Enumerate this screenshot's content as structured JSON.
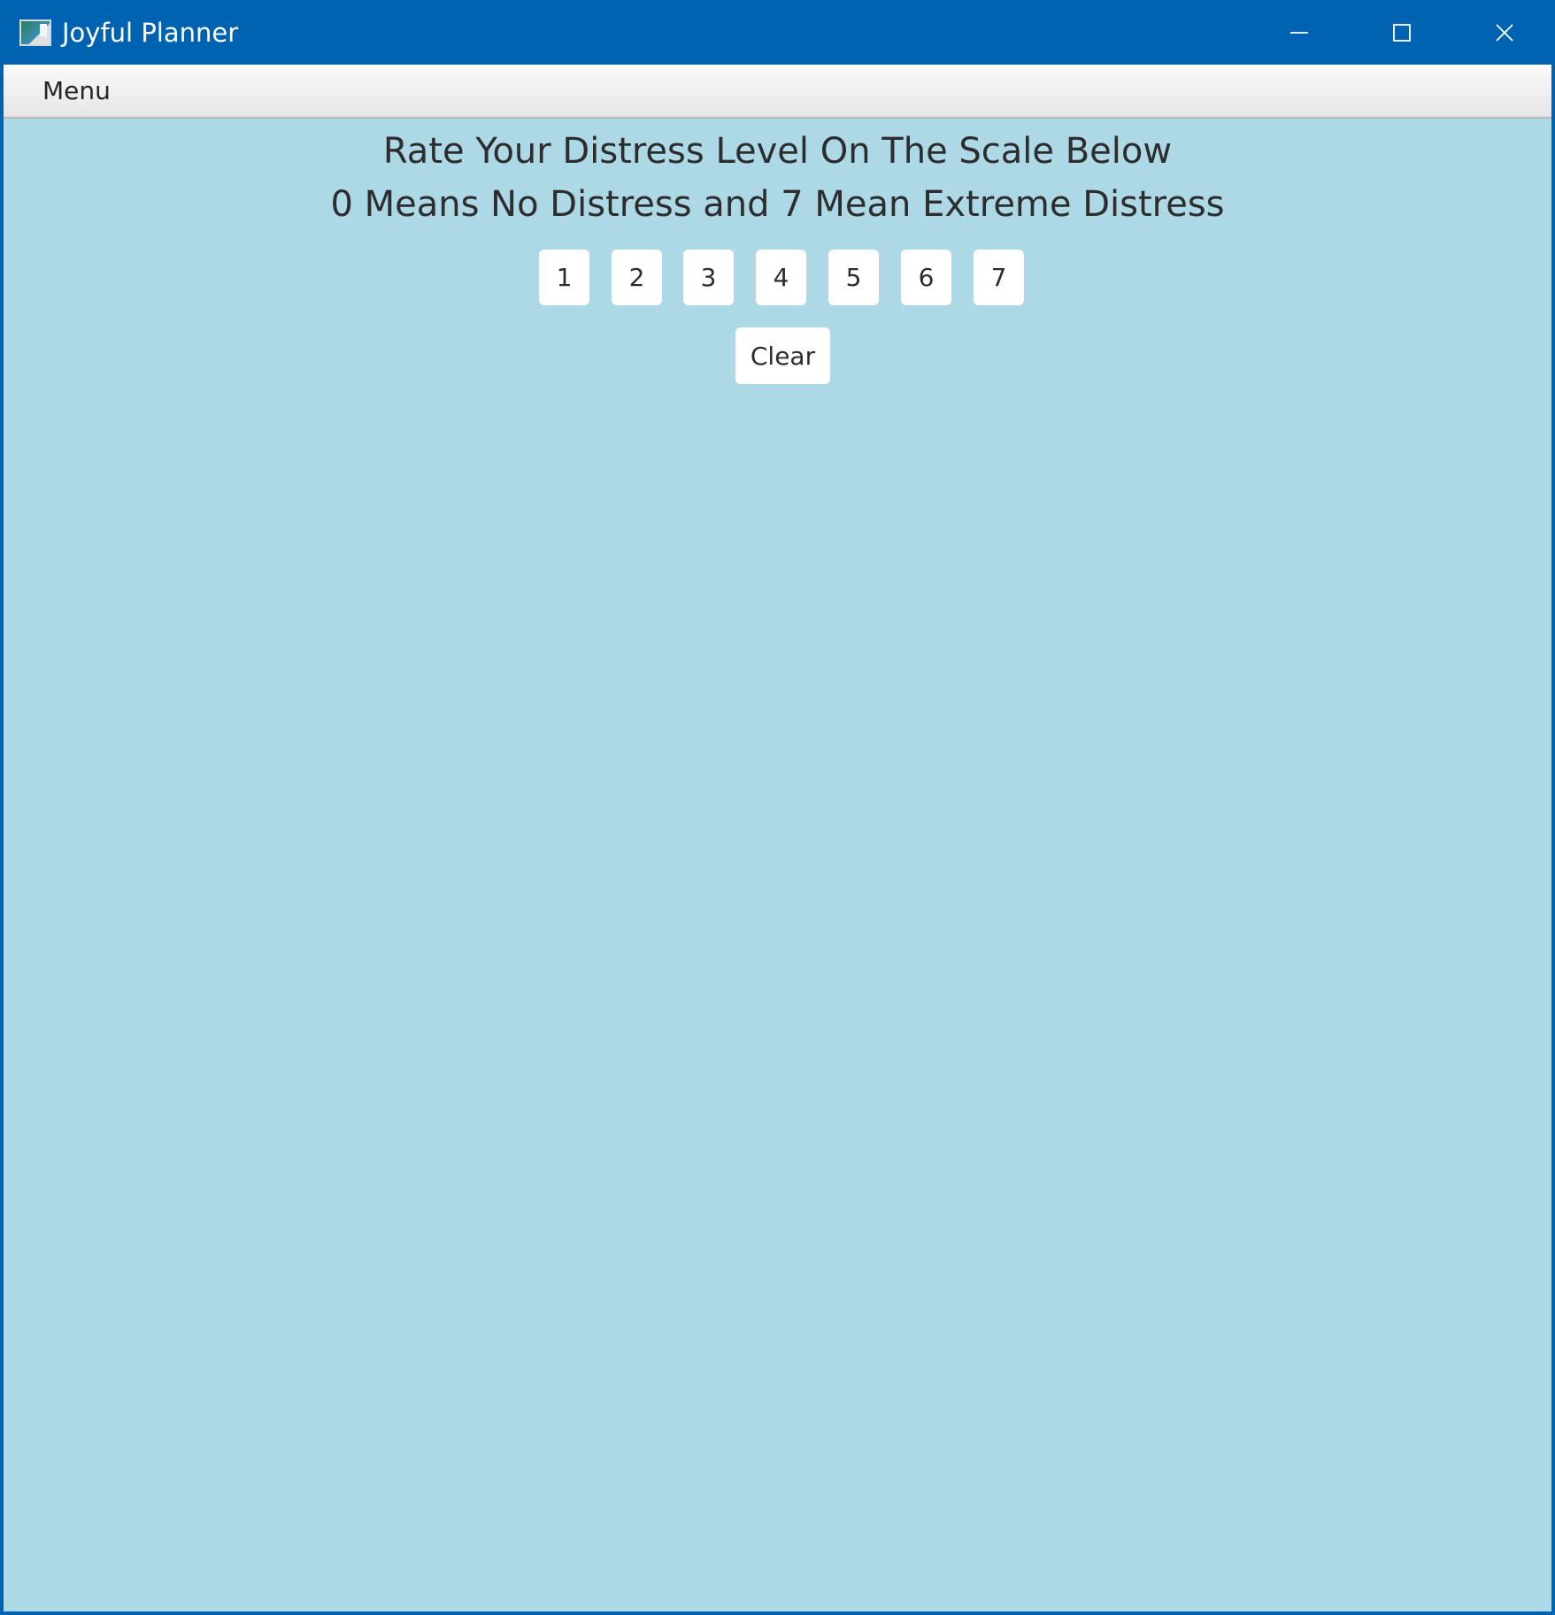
{
  "window": {
    "title": "Joyful Planner",
    "controls": {
      "minimize_icon": "minimize-icon",
      "maximize_icon": "maximize-icon",
      "close_icon": "close-icon"
    }
  },
  "menubar": {
    "items": [
      {
        "label": "Menu"
      }
    ]
  },
  "main": {
    "heading_line1": "Rate Your Distress Level On The Scale Below",
    "heading_line2": "0 Means No Distress and 7 Mean Extreme Distress",
    "rating_buttons": [
      "1",
      "2",
      "3",
      "4",
      "5",
      "6",
      "7"
    ],
    "clear_label": "Clear"
  },
  "colors": {
    "titlebar": "#0063b1",
    "background": "#add8e6",
    "button": "#ffffff",
    "text": "#2d2d2d"
  }
}
